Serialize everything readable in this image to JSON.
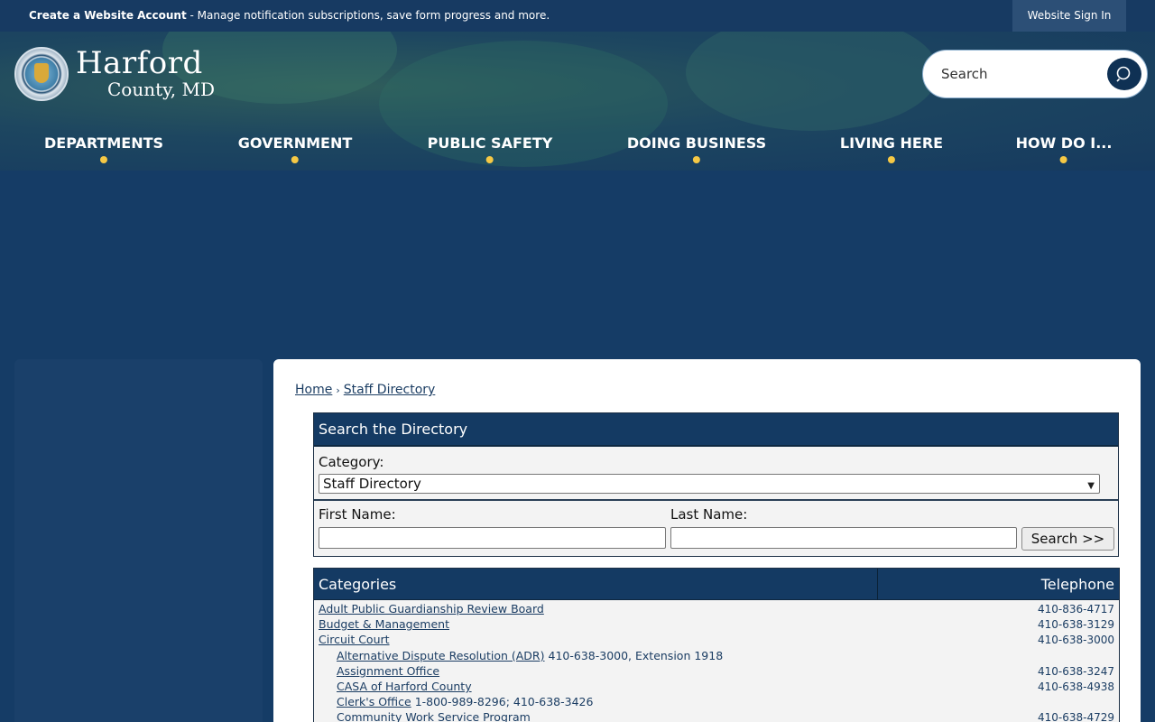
{
  "topbar": {
    "notice_strong": "Create a Website Account",
    "notice_rest": " - Manage notification subscriptions, save form progress and more.",
    "signin": "Website Sign In"
  },
  "header": {
    "logo_main": "Harford",
    "logo_sub": "County, MD",
    "seal_text": "Harford County Maryland"
  },
  "search": {
    "placeholder": "Search"
  },
  "nav": [
    {
      "label": "DEPARTMENTS"
    },
    {
      "label": "GOVERNMENT"
    },
    {
      "label": "PUBLIC SAFETY"
    },
    {
      "label": "DOING BUSINESS"
    },
    {
      "label": "LIVING HERE"
    },
    {
      "label": "HOW DO I..."
    }
  ],
  "breadcrumb": {
    "home": "Home",
    "sep": "›",
    "current": "Staff Directory"
  },
  "directory": {
    "heading": "Search the Directory",
    "category_label": "Category:",
    "category_value": "Staff Directory",
    "first_name_label": "First Name:",
    "last_name_label": "Last Name:",
    "search_button": "Search >>"
  },
  "table": {
    "col_categories": "Categories",
    "col_telephone": "Telephone",
    "rows": [
      {
        "name": "Adult Public Guardianship Review Board",
        "extra": "",
        "tel": "410-836-4717",
        "indent": false
      },
      {
        "name": "Budget & Management",
        "extra": "",
        "tel": "410-638-3129",
        "indent": false
      },
      {
        "name": "Circuit Court",
        "extra": "",
        "tel": "410-638-3000",
        "indent": false
      },
      {
        "name": "Alternative Dispute Resolution (ADR)",
        "extra": "410-638-3000, Extension 1918",
        "tel": "",
        "indent": true
      },
      {
        "name": "Assignment Office",
        "extra": "",
        "tel": "410-638-3247",
        "indent": true
      },
      {
        "name": "CASA of Harford County",
        "extra": "",
        "tel": "410-638-4938",
        "indent": true
      },
      {
        "name": "Clerk's Office",
        "extra": "1-800-989-8296; 410-638-3426",
        "tel": "",
        "indent": true
      },
      {
        "name": "Community Work Service Program",
        "extra": "",
        "tel": "410-638-4729",
        "indent": true
      }
    ]
  }
}
